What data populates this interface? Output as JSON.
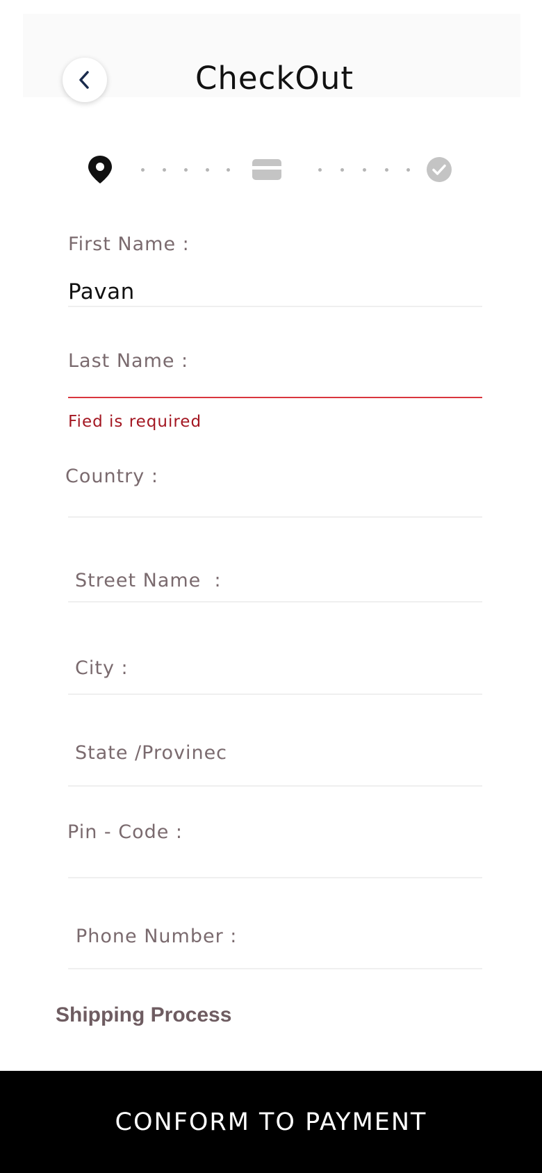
{
  "header": {
    "title": "CheckOut",
    "back_icon": "chevron-left-icon"
  },
  "stepper": {
    "steps": [
      {
        "icon": "location-pin-icon",
        "state": "active"
      },
      {
        "icon": "credit-card-icon",
        "state": "inactive"
      },
      {
        "icon": "check-circle-icon",
        "state": "inactive"
      }
    ]
  },
  "form": {
    "first_name": {
      "label": "First Name :",
      "value": "Pavan"
    },
    "last_name": {
      "label": "Last Name :",
      "value": "",
      "error": "Fied is required"
    },
    "country": {
      "label": "Country :",
      "value": ""
    },
    "street_name": {
      "label": "Street Name  :",
      "value": ""
    },
    "city": {
      "label": "City :",
      "value": ""
    },
    "state": {
      "label": "State /Provinec",
      "value": ""
    },
    "pin_code": {
      "label": "Pin - Code :",
      "value": ""
    },
    "phone_number": {
      "label": "Phone Number :",
      "value": ""
    }
  },
  "section": {
    "title": "Shipping Process"
  },
  "footer": {
    "button_label": "CONFORM TO PAYMENT"
  },
  "colors": {
    "accent_dark": "#1a2b4c",
    "label": "#7a6a6e",
    "error": "#a31621",
    "error_line": "#d9363e",
    "inactive_step": "#c4c4c4",
    "button_bg": "#000000"
  }
}
